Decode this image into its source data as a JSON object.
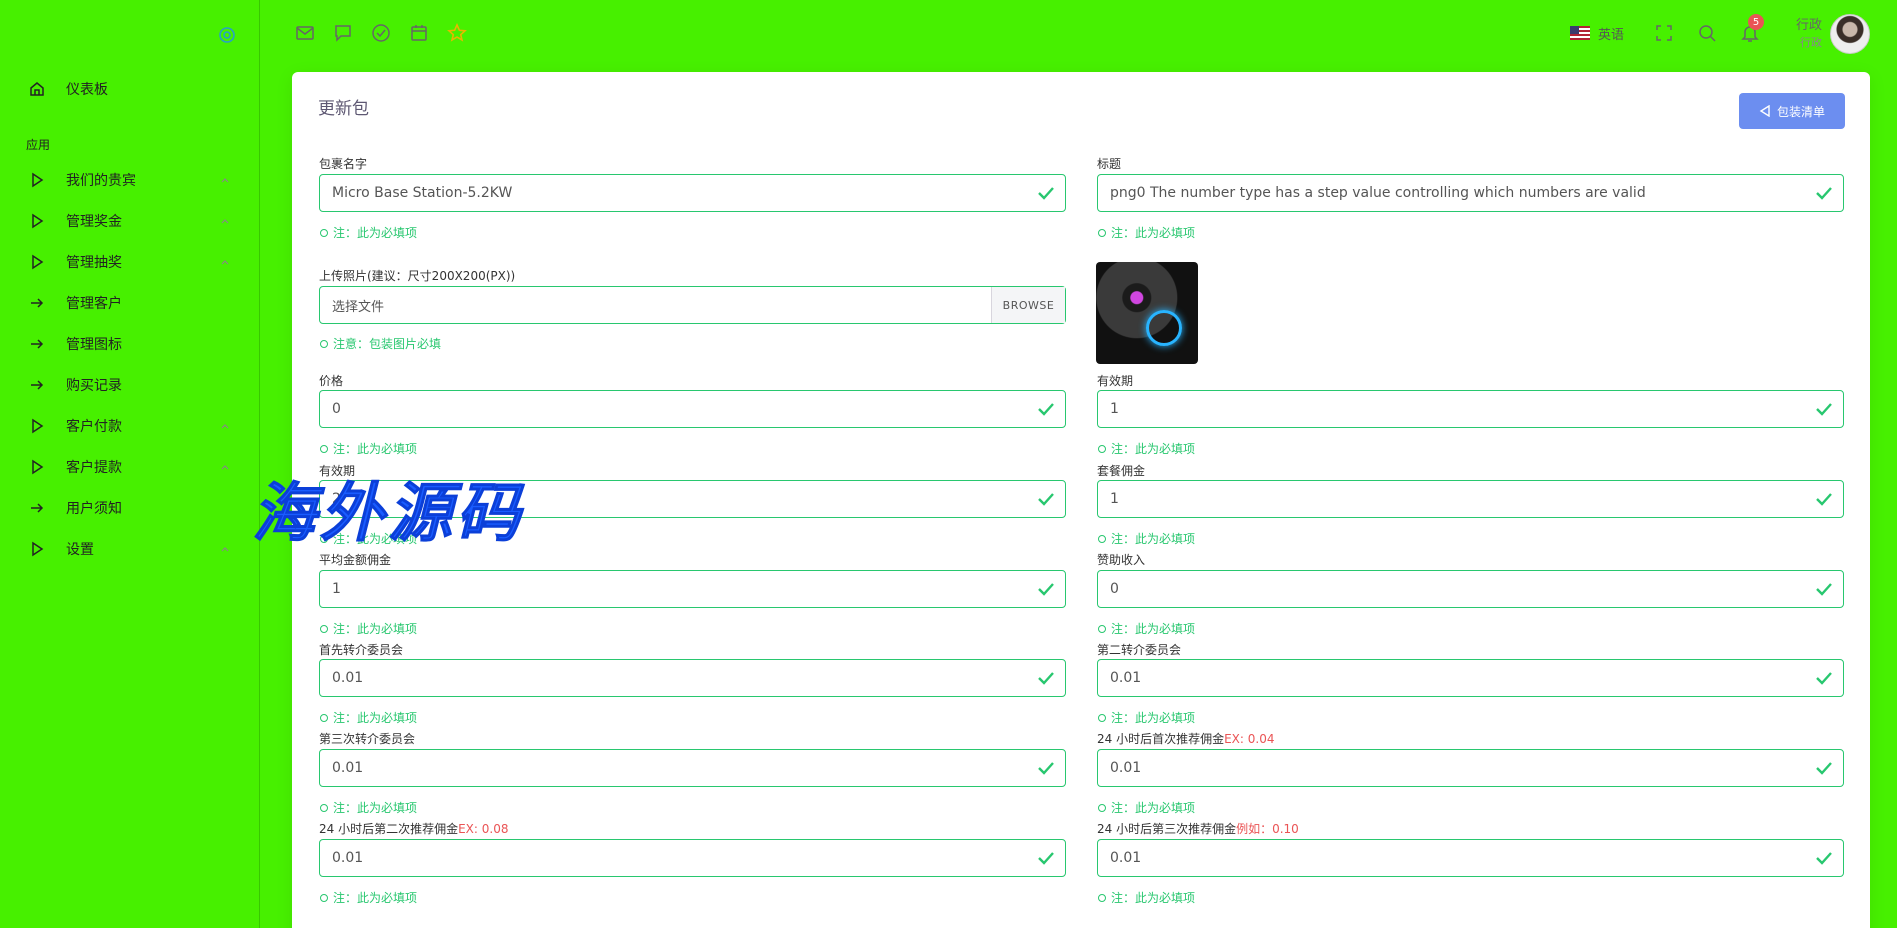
{
  "sidebar": {
    "section_title": "应用",
    "items": [
      {
        "label": "仪表板",
        "icon": "home-icon"
      },
      {
        "label": "我们的贵宾",
        "icon": "play-icon"
      },
      {
        "label": "管理奖金",
        "icon": "play-icon"
      },
      {
        "label": "管理抽奖",
        "icon": "play-icon"
      },
      {
        "label": "管理客户",
        "icon": "arrow-right-icon"
      },
      {
        "label": "管理图标",
        "icon": "arrow-right-icon"
      },
      {
        "label": "购买记录",
        "icon": "arrow-right-icon"
      },
      {
        "label": "客户付款",
        "icon": "play-icon"
      },
      {
        "label": "客户提款",
        "icon": "play-icon"
      },
      {
        "label": "用户须知",
        "icon": "arrow-right-icon"
      },
      {
        "label": "设置",
        "icon": "play-icon"
      }
    ]
  },
  "topbar": {
    "language": "英语",
    "notification_count": "5",
    "user_name": "行政",
    "user_role": "行政"
  },
  "card": {
    "title": "更新包",
    "list_button": "包装清单"
  },
  "form": {
    "package_name": {
      "label": "包裹名字",
      "value": "Micro Base Station-5.2KW",
      "hint": "注：此为必填项"
    },
    "title": {
      "label": "标题",
      "value": "png0 The number type has a step value controlling which numbers are valid",
      "hint": "注：此为必填项"
    },
    "photo": {
      "label": "上传照片(建议：尺寸200X200(PX))",
      "file_text": "选择文件",
      "browse": "BROWSE",
      "hint": "注意：包装图片必填"
    },
    "price": {
      "label": "价格",
      "value": "0",
      "hint": "注：此为必填项"
    },
    "validity_right": {
      "label": "有效期",
      "value": "1",
      "hint": "注：此为必填项"
    },
    "validity_left": {
      "label": "有效期",
      "value": "2",
      "hint": "注：此为必填项"
    },
    "package_commission": {
      "label": "套餐佣金",
      "value": "1",
      "hint": "注：此为必填项"
    },
    "avg_commission": {
      "label": "平均金额佣金",
      "value": "1",
      "hint": "注：此为必填项"
    },
    "sponsor_income": {
      "label": "赞助收入",
      "value": "0",
      "hint": "注：此为必填项"
    },
    "first_referral": {
      "label": "首先转介委员会",
      "value": "0.01",
      "hint": "注：此为必填项"
    },
    "second_referral": {
      "label": "第二转介委员会",
      "value": "0.01",
      "hint": "注：此为必填项"
    },
    "third_referral": {
      "label": "第三次转介委员会",
      "value": "0.01",
      "hint": "注：此为必填项"
    },
    "first_24h": {
      "label": "24 小时后首次推荐佣金",
      "ex": "EX: 0.04",
      "value": "0.01",
      "hint": "注：此为必填项"
    },
    "second_24h": {
      "label": "24 小时后第二次推荐佣金",
      "ex": "EX: 0.08",
      "value": "0.01",
      "hint": "注：此为必填项"
    },
    "third_24h": {
      "label": "24 小时后第三次推荐佣金",
      "ex": "例如：0.10",
      "value": "0.01",
      "hint": "注：此为必填项"
    }
  },
  "watermark": "海外源码",
  "colors": {
    "success": "#28c76f",
    "primary": "#6c8ef0",
    "background": "#47f000",
    "danger": "#ea5455"
  }
}
